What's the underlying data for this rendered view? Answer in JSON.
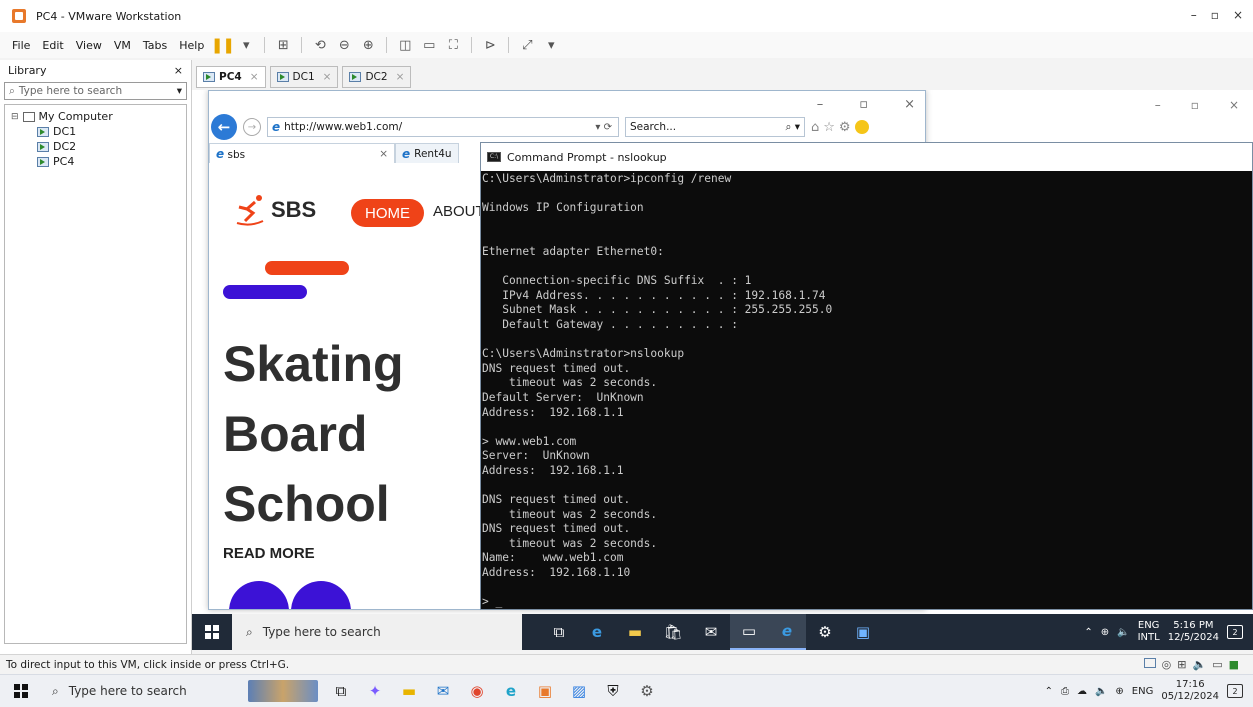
{
  "window": {
    "title": "PC4 - VMware Workstation",
    "controls": [
      "–",
      "▫",
      "×"
    ]
  },
  "menu": [
    "File",
    "Edit",
    "View",
    "VM",
    "Tabs",
    "Help"
  ],
  "library": {
    "title": "Library",
    "close": "×",
    "search_placeholder": "Type here to search",
    "tree_root": "My Computer",
    "items": [
      "DC1",
      "DC2",
      "PC4"
    ]
  },
  "vm_tabs": [
    {
      "label": "PC4",
      "active": true
    },
    {
      "label": "DC1",
      "active": false
    },
    {
      "label": "DC2",
      "active": false
    }
  ],
  "browser": {
    "url": "http://www.web1.com/",
    "search_placeholder": "Search...",
    "tabs": [
      "sbs",
      "Rent4u"
    ],
    "site": {
      "logo_text": "SBS",
      "nav_home": "HOME",
      "nav_about": "ABOUT",
      "hero_lines": [
        "Skating",
        "Board",
        "School"
      ],
      "read_more": "READ MORE"
    }
  },
  "cmd": {
    "title": "Command Prompt - nslookup",
    "lines": [
      "C:\\Users\\Adminstrator>ipconfig /renew",
      "",
      "Windows IP Configuration",
      "",
      "",
      "Ethernet adapter Ethernet0:",
      "",
      "   Connection-specific DNS Suffix  . : 1",
      "   IPv4 Address. . . . . . . . . . . : 192.168.1.74",
      "   Subnet Mask . . . . . . . . . . . : 255.255.255.0",
      "   Default Gateway . . . . . . . . . :",
      "",
      "C:\\Users\\Adminstrator>nslookup",
      "DNS request timed out.",
      "    timeout was 2 seconds.",
      "Default Server:  UnKnown",
      "Address:  192.168.1.1",
      "",
      "> www.web1.com",
      "Server:  UnKnown",
      "Address:  192.168.1.1",
      "",
      "DNS request timed out.",
      "    timeout was 2 seconds.",
      "DNS request timed out.",
      "    timeout was 2 seconds.",
      "Name:    www.web1.com",
      "Address:  192.168.1.10",
      "",
      "> _"
    ]
  },
  "guest_taskbar": {
    "search_placeholder": "Type here to search",
    "lang": "ENG",
    "layout": "INTL",
    "time": "5:16 PM",
    "date": "12/5/2024",
    "notif_count": "2"
  },
  "status_bar": {
    "text": "To direct input to this VM, click inside or press Ctrl+G."
  },
  "host_taskbar": {
    "search_placeholder": "Type here to search",
    "lang": "ENG",
    "time": "17:16",
    "date": "05/12/2024",
    "notif_count": "2"
  },
  "colors": {
    "accent_red": "#ef4318",
    "accent_blue": "#3c12d6",
    "cmd_bg": "#0c0c0c",
    "taskbar": "#202a38"
  }
}
